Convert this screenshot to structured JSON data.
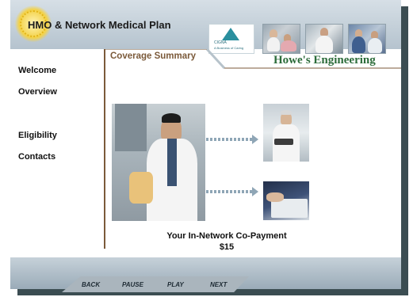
{
  "app": {
    "title": "HMO & Network Medical Plan"
  },
  "branding": {
    "cigna_name": "CIGNA",
    "cigna_tagline": "A Business of Caring",
    "company_name": "Howe's Engineering",
    "accent_color": "#7b5a3a",
    "company_color": "#2c6c3a"
  },
  "section": {
    "title": "Coverage Summary"
  },
  "sidebar": {
    "items": [
      {
        "label": "Welcome"
      },
      {
        "label": "Overview"
      },
      {
        "label": "Eligibility"
      },
      {
        "label": "Contacts"
      }
    ]
  },
  "content": {
    "copay_label": "Your In-Network Co-Payment",
    "copay_value": "$15"
  },
  "controls": {
    "back": "BACK",
    "pause": "PAUSE",
    "play": "PLAY",
    "next": "NEXT"
  }
}
